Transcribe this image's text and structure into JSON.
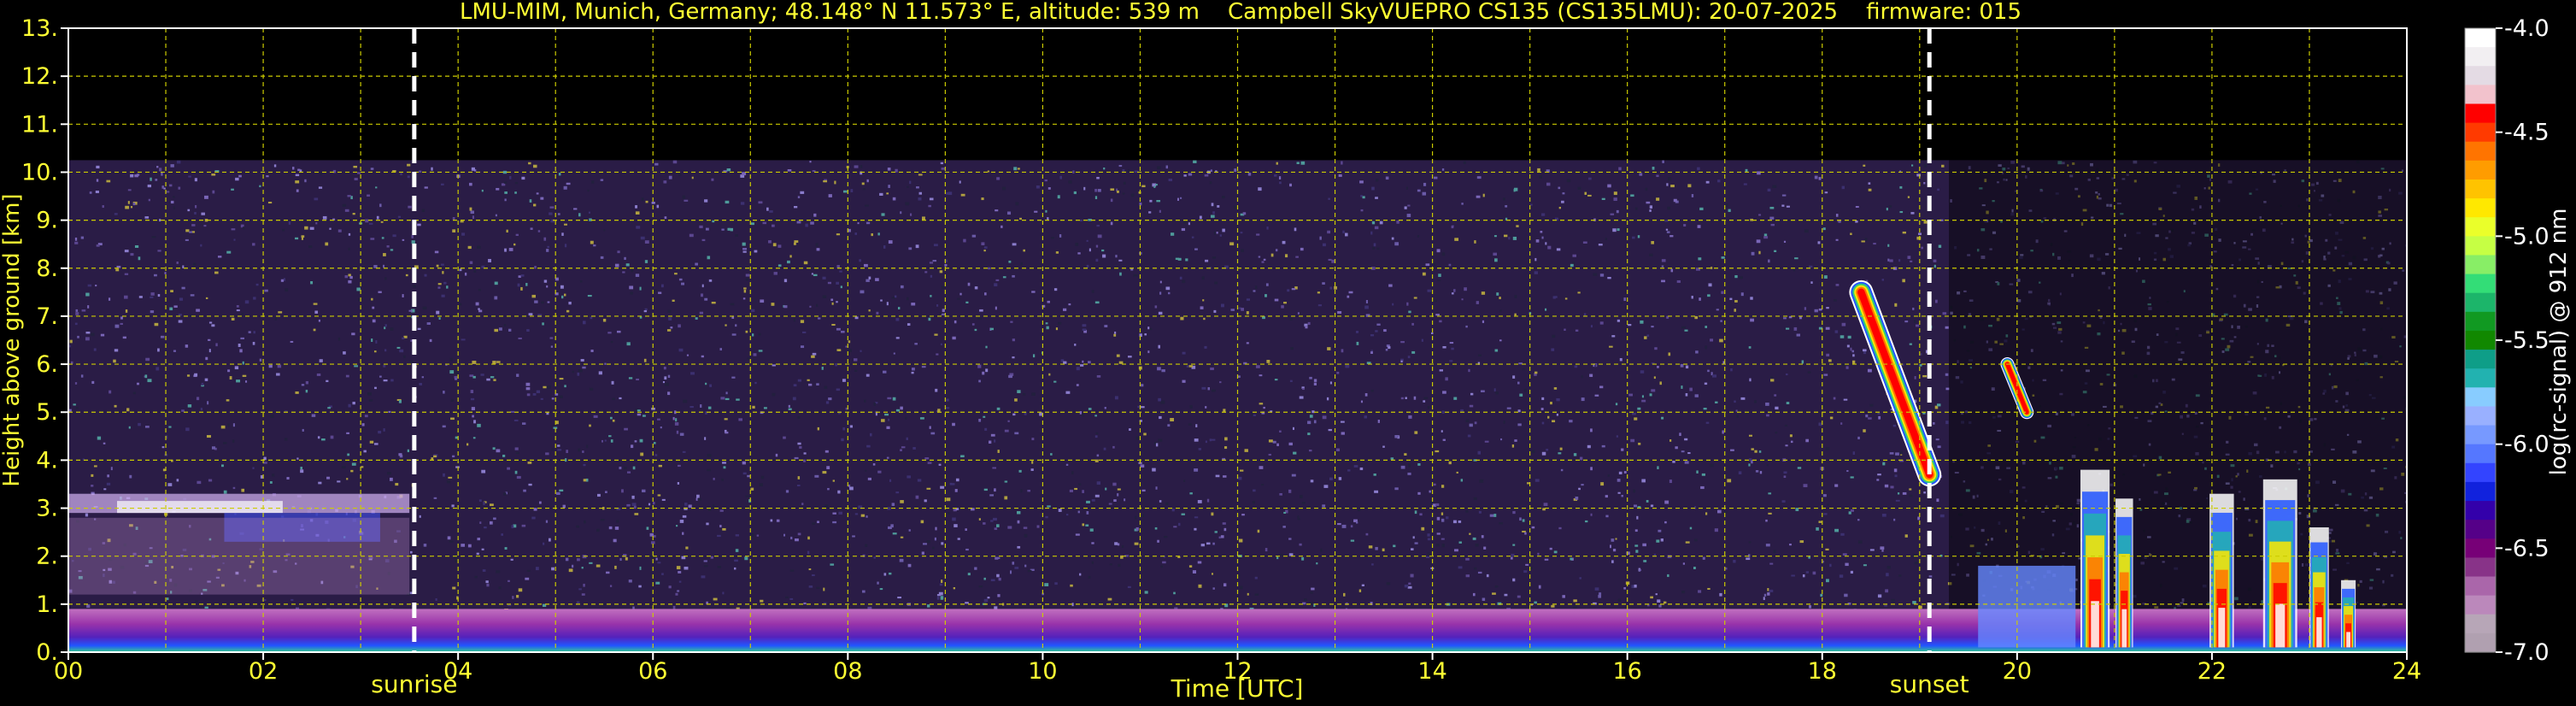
{
  "chart_data": {
    "type": "heatmap",
    "title": "LMU-MIM, Munich, Germany; 48.148° N 11.573° E, altitude: 539 m    Campbell SkyVUEPRO CS135 (CS135LMU): 20-07-2025    firmware: 015",
    "xlabel": "Time [UTC]",
    "ylabel": "Height above ground [km]",
    "xlim": [
      0,
      24
    ],
    "ylim": [
      0,
      13
    ],
    "x_ticks": [
      "00",
      "02",
      "04",
      "06",
      "08",
      "10",
      "12",
      "14",
      "16",
      "18",
      "20",
      "22",
      "24"
    ],
    "y_ticks": [
      "0.",
      "1.",
      "2.",
      "3.",
      "4.",
      "5.",
      "6.",
      "7.",
      "8.",
      "9.",
      "10.",
      "11.",
      "12.",
      "13."
    ],
    "grid": true,
    "markers": [
      {
        "label": "sunrise",
        "time": 3.55
      },
      {
        "label": "sunset",
        "time": 19.1
      }
    ],
    "colorbar": {
      "label": "log(rc-signal) @ 912 nm",
      "range": [
        -7.0,
        -4.0
      ],
      "ticks": [
        "-4.0",
        "-4.5",
        "-5.0",
        "-5.5",
        "-6.0",
        "-6.5",
        "-7.0"
      ],
      "colors": [
        "#ffffff",
        "#f2eff2",
        "#e4dbe4",
        "#f2c2cc",
        "#ff0000",
        "#ff3a00",
        "#ff7400",
        "#ff9c00",
        "#ffc300",
        "#ffe800",
        "#eaff2a",
        "#c6ff44",
        "#88ee66",
        "#33dd77",
        "#1cb56a",
        "#119922",
        "#118800",
        "#0e9e88",
        "#22b2b0",
        "#88ccff",
        "#99b0ff",
        "#7799ff",
        "#5577ff",
        "#3344ff",
        "#1122dd",
        "#3300aa",
        "#550088",
        "#770077",
        "#883388",
        "#aa66aa",
        "#bb88bb",
        "#b7a6b7",
        "#b0a0b0"
      ]
    },
    "features": [
      {
        "desc": "aerosol boundary layer",
        "t_start": 0,
        "t_end": 24,
        "h_top_km": 0.9
      },
      {
        "desc": "residual layer",
        "t_start": 0,
        "t_end": 3.5,
        "h_bottom_km": 2.9,
        "h_top_km": 3.3
      },
      {
        "desc": "cirrus",
        "t_start": 18.0,
        "t_end": 19.1,
        "h_bottom_km": 3.3,
        "h_top_km": 7.6
      },
      {
        "desc": "cirrus",
        "t_start": 19.8,
        "t_end": 20.2,
        "h_bottom_km": 4.9,
        "h_top_km": 6.0
      },
      {
        "desc": "convective clouds",
        "t_start": 20.5,
        "t_end": 24.0,
        "h_bottom_km": 0.1,
        "h_top_km": 3.9
      }
    ],
    "noise_ceiling_km": 10.25
  }
}
